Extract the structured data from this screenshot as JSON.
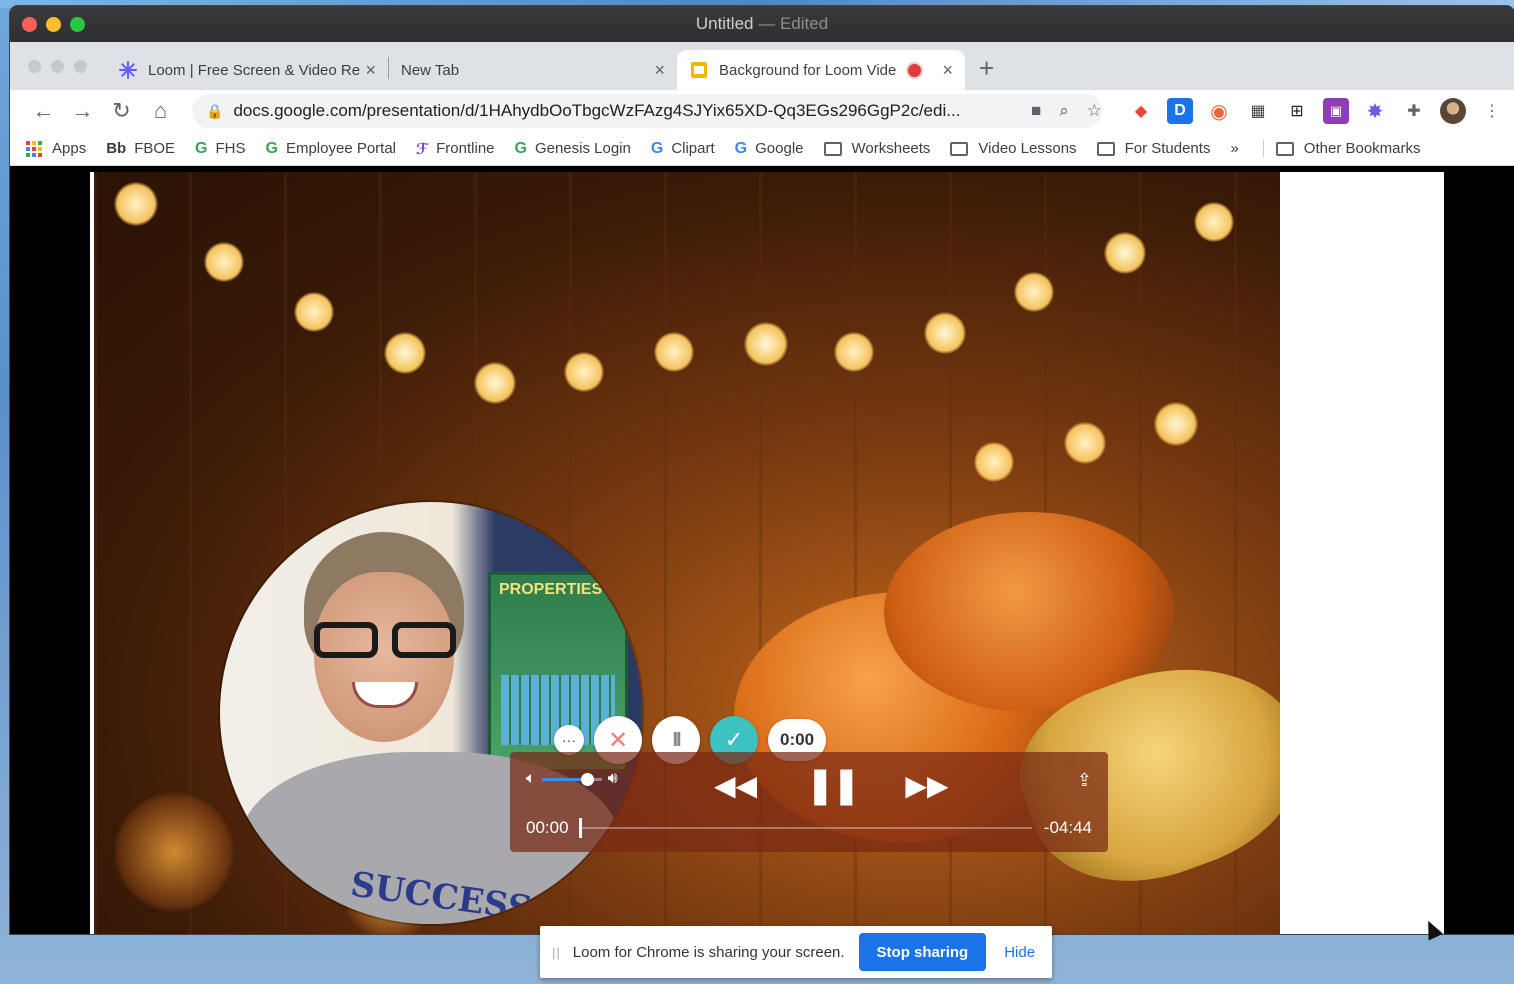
{
  "window": {
    "title": "Untitled",
    "title_suffix": "— Edited"
  },
  "tabs": [
    {
      "label": "Loom | Free Screen & Video Re",
      "close": "×"
    },
    {
      "label": "New Tab",
      "close": "×"
    },
    {
      "label": "Background for Loom Vide",
      "close": "×"
    }
  ],
  "new_tab_symbol": "+",
  "toolbar": {
    "back": "←",
    "forward": "→",
    "reload": "↻",
    "home": "⌂",
    "url": "docs.google.com/presentation/d/1HAhydbOoTbgcWzFAzg4SJYix65XD-Qq3EGs296GgP2c/edi...",
    "lock": "🔒"
  },
  "extensions": [
    "D",
    "⋮"
  ],
  "bookmarks": {
    "items": [
      "Apps",
      "FBOE",
      "FHS",
      "Employee Portal",
      "Frontline",
      "Genesis Login",
      "Clipart",
      "Google",
      "Worksheets",
      "Video Lessons",
      "For Students"
    ],
    "bb_label": "Bb",
    "more": "»",
    "other": "Other Bookmarks"
  },
  "slide": {
    "poster_text": "PROPERTIES",
    "shirt_text": "SUCCESS"
  },
  "loom_controls": {
    "more": "···",
    "cancel": "✕",
    "pause": "II",
    "done": "✓",
    "timer": "0:00"
  },
  "player": {
    "current_time": "00:00",
    "remaining_time": "-04:44",
    "volume_level": 0.75,
    "progress": 0
  },
  "share_banner": {
    "message": "Loom for Chrome is sharing your screen.",
    "stop_label": "Stop sharing",
    "hide_label": "Hide"
  },
  "colors": {
    "accent_blue": "#1a73e8",
    "loom_teal": "#3ec1c1",
    "record_red": "#e03b3b"
  }
}
